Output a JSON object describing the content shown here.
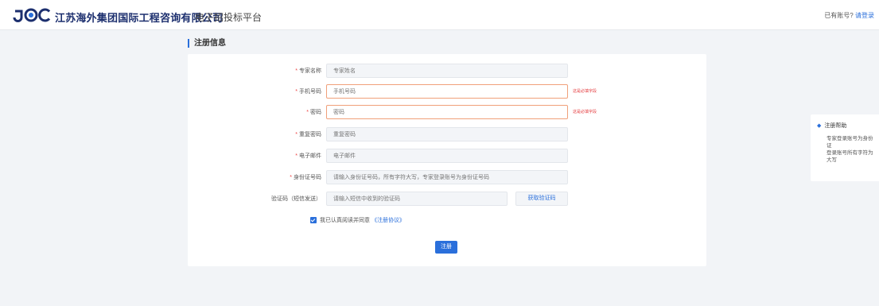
{
  "header": {
    "logo_text": "JOC",
    "company": "江苏海外集团国际工程咨询有限公司",
    "platform": "电子招投标平台",
    "account_prompt": "已有账号?",
    "login_link": "请登录"
  },
  "section_title": "注册信息",
  "form": {
    "fields": [
      {
        "label": "专家名称",
        "required": true,
        "placeholder": "专家姓名",
        "error": ""
      },
      {
        "label": "手机号码",
        "required": true,
        "placeholder": "手机号码",
        "error": "这是必填字段"
      },
      {
        "label": "密码",
        "required": true,
        "placeholder": "密码",
        "error": "这是必填字段"
      },
      {
        "label": "重复密码",
        "required": true,
        "placeholder": "重复密码",
        "error": ""
      },
      {
        "label": "电子邮件",
        "required": true,
        "placeholder": "电子邮件",
        "error": ""
      },
      {
        "label": "身份证号码",
        "required": true,
        "placeholder": "请输入身份证号码，所有字符大写，专家登录账号为身份证号码",
        "error": ""
      },
      {
        "label": "验证码（短信发送）",
        "required": false,
        "placeholder": "请输入短信中收到的验证码",
        "error": ""
      }
    ],
    "get_code_button": "获取验证码",
    "agree_text": "我已认真阅读并同意",
    "agree_link": "《注册协议》",
    "submit_label": "注册"
  },
  "help": {
    "title": "注册帮助",
    "body": "专家登录账号为身份证\n登录账号所有字符为大写"
  },
  "colors": {
    "accent": "#2a6fdb",
    "error": "#e4393c",
    "error_border": "#f0a07a",
    "background": "#f2f4f7"
  }
}
